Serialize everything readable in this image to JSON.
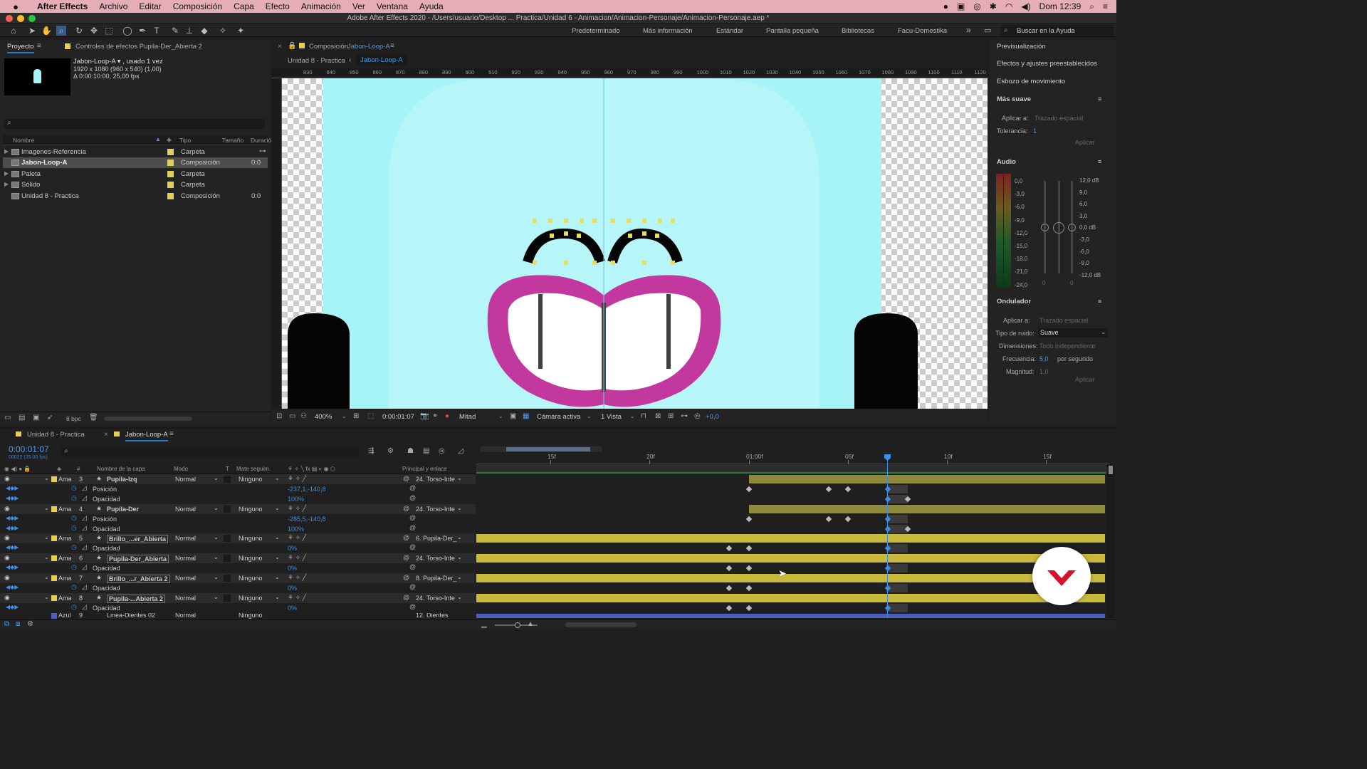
{
  "menubar": {
    "app": "After Effects",
    "items": [
      "Archivo",
      "Editar",
      "Composición",
      "Capa",
      "Efecto",
      "Animación",
      "Ver",
      "Ventana",
      "Ayuda"
    ],
    "clock": "Dom 12:39"
  },
  "window_title": "Adobe After Effects 2020 - /Users/usuario/Desktop ... Practica/Unidad 6 - Animacion/Animacion-Personaje/Animacion-Personaje.aep *",
  "workspaces": [
    "Predeterminado",
    "Más información",
    "Estándar",
    "Pantalla pequeña",
    "Bibliotecas",
    "Facu-Domestika"
  ],
  "help_search_placeholder": "Buscar en la Ayuda",
  "project": {
    "tab": "Proyecto",
    "effect_controls_tab": "Controles de efectos Pupila-Der_Abierta 2",
    "selected_name": "Jabon-Loop-A ▾ , usado 1 vez",
    "selected_dims": "1920 x 1080  (960 x 540) (1,00)",
    "selected_dur": "Δ 0:00:10:00, 25,00 fps",
    "columns": {
      "name": "Nombre",
      "type": "Tipo",
      "size": "Tamaño",
      "duration": "Duració"
    },
    "rows": [
      {
        "name": "Imagenes-Referencia",
        "type": "Carpeta",
        "dur": ""
      },
      {
        "name": "Jabon-Loop-A",
        "type": "Composición",
        "dur": "0:0"
      },
      {
        "name": "Paleta",
        "type": "Carpeta",
        "dur": ""
      },
      {
        "name": "Sólido",
        "type": "Carpeta",
        "dur": ""
      },
      {
        "name": "Unidad 8 - Practica",
        "type": "Composición",
        "dur": "0:0"
      }
    ],
    "bpc": "8 bpc"
  },
  "composition": {
    "panel_label": "Composición",
    "panel_comp": "Jabon-Loop-A",
    "crumb1": "Unidad 8 - Practica",
    "crumb2": "Jabon-Loop-A",
    "ruler_labels": [
      "830",
      "840",
      "850",
      "860",
      "870",
      "880",
      "890",
      "900",
      "910",
      "920",
      "930",
      "940",
      "950",
      "960",
      "970",
      "980",
      "990",
      "1000",
      "1010",
      "1020",
      "1030",
      "1040",
      "1050",
      "1060",
      "1070",
      "1080",
      "1090",
      "1100",
      "1110",
      "1120"
    ],
    "zoom": "400%",
    "time": "0:00:01:07",
    "resolution": "Mitad",
    "camera": "Cámara activa",
    "views": "1 Vista",
    "exposure": "+0,0"
  },
  "right_panel": {
    "sections": [
      "Previsualización",
      "Efectos y ajustes preestablecidos",
      "Esbozo de movimiento"
    ],
    "smoother": {
      "title": "Más suave",
      "apply_label": "Aplicar a:",
      "apply_value": "Trazado espacial",
      "tolerance_label": "Tolerancia:",
      "tolerance_value": "1",
      "apply_button": "Aplicar"
    },
    "audio": {
      "title": "Audio",
      "left_scale": [
        "0,0",
        "-3,0",
        "-6,0",
        "-9,0",
        "-12,0",
        "-15,0",
        "-18,0",
        "-21,0",
        "-24,0"
      ],
      "right_scale": [
        "12,0 dB",
        "9,0",
        "6,0",
        "3,0",
        "0,0 dB",
        "-3,0",
        "-6,0",
        "-9,0",
        "-12,0 dB"
      ],
      "zero_a": "0",
      "zero_b": "0"
    },
    "wiggler": {
      "title": "Ondulador",
      "apply_label": "Aplicar a:",
      "apply_value": "Trazado espacial",
      "noise_label": "Tipo de ruido:",
      "noise_value": "Suave",
      "dims_label": "Dimensiones:",
      "dims_value": "Todo independiente",
      "freq_label": "Frecuencia:",
      "freq_value": "5,0",
      "freq_unit": "por segundo",
      "mag_label": "Magnitud:",
      "mag_value": "1,0",
      "apply_button": "Aplicar"
    }
  },
  "timeline": {
    "tab1": "Unidad 8 - Practica",
    "tab2": "Jabon-Loop-A",
    "current_time": "0:00:01:07",
    "frame_info": "00032 (25.00 fps)",
    "columns": {
      "layer_name": "Nombre de la capa",
      "mode": "Modo",
      "t": "T",
      "matte": "Mate seguim.",
      "parent": "Principal y enlace"
    },
    "ruler": [
      "15f",
      "20f",
      "01:00f",
      "05f",
      "10f",
      "15f"
    ],
    "layers": [
      {
        "color": "Ama",
        "num": "3",
        "name": "Pupila-Izq",
        "mode": "Normal",
        "matte": "Ninguno",
        "parent": "24. Torso-Inte",
        "boxed": false,
        "props": [
          {
            "name": "Posición",
            "value": "-237,1,-140,8"
          },
          {
            "name": "Opacidad",
            "value": "100%"
          }
        ]
      },
      {
        "color": "Ama",
        "num": "4",
        "name": "Pupila-Der",
        "mode": "Normal",
        "matte": "Ninguno",
        "parent": "24. Torso-Inte",
        "boxed": false,
        "props": [
          {
            "name": "Posición",
            "value": "-285,5,-140,8"
          },
          {
            "name": "Opacidad",
            "value": "100%"
          }
        ]
      },
      {
        "color": "Ama",
        "num": "5",
        "name": "Brillo_...er_Abierta",
        "mode": "Normal",
        "matte": "Ninguno",
        "parent": "6. Pupila-Der_",
        "boxed": true,
        "props": [
          {
            "name": "Opacidad",
            "value": "0%"
          }
        ]
      },
      {
        "color": "Ama",
        "num": "6",
        "name": "Pupila-Der_Abierta",
        "mode": "Normal",
        "matte": "Ninguno",
        "parent": "24. Torso-Inte",
        "boxed": true,
        "props": [
          {
            "name": "Opacidad",
            "value": "0%"
          }
        ]
      },
      {
        "color": "Ama",
        "num": "7",
        "name": "Brillo_...r_Abierta 2",
        "mode": "Normal",
        "matte": "Ninguno",
        "parent": "8. Pupila-Der_",
        "boxed": true,
        "props": [
          {
            "name": "Opacidad",
            "value": "0%"
          }
        ]
      },
      {
        "color": "Ama",
        "num": "8",
        "name": "Pupila-...Abierta 2",
        "mode": "Normal",
        "matte": "Ninguno",
        "parent": "24. Torso-Inte",
        "boxed": true,
        "props": [
          {
            "name": "Opacidad",
            "value": "0%"
          }
        ]
      }
    ],
    "last_row": {
      "color": "Azul",
      "num": "9",
      "name": "Linea-Dientes 02",
      "mode": "Normal",
      "matte": "Ninguno",
      "parent": "12. Dientes"
    }
  },
  "colors": {
    "accent": "#1e79d8",
    "yellow_bar": "#c9b93a",
    "olive_bar": "#8f8a3a",
    "sky": "#a6f4f7",
    "lip": "#c2389e"
  }
}
